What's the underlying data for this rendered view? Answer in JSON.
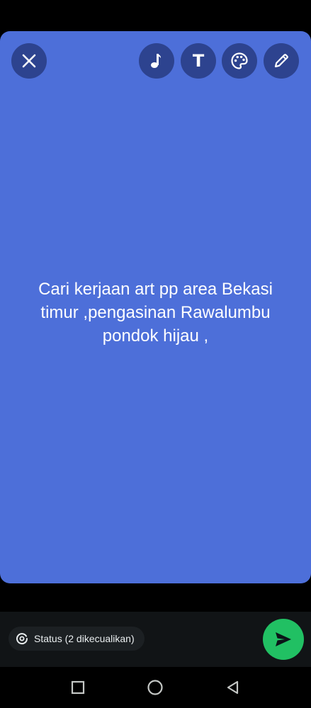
{
  "toolbar": {
    "close_icon": "close-icon",
    "music_icon": "music-note-icon",
    "text_label": "T",
    "text_icon": "text-icon",
    "palette_icon": "palette-icon",
    "pencil_icon": "pencil-icon"
  },
  "status": {
    "background_color": "#4d6fd9",
    "text": "Cari kerjaan art pp area Bekasi timur ,pengasinan Rawalumbu pondok hijau ,"
  },
  "composer": {
    "audience_icon": "privacy-status-icon",
    "audience_label": "Status (2 dikecualikan)",
    "send_icon": "send-icon",
    "send_color": "#21c063"
  },
  "navigation": {
    "recents_icon": "square-icon",
    "home_icon": "circle-icon",
    "back_icon": "triangle-back-icon"
  }
}
